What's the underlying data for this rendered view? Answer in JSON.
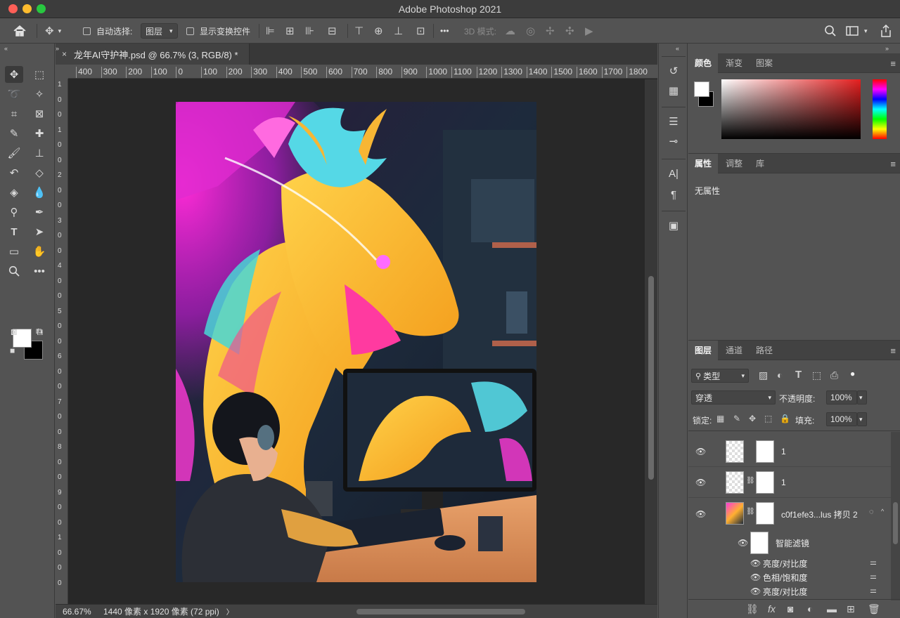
{
  "window": {
    "title": "Adobe Photoshop 2021"
  },
  "options_bar": {
    "auto_select_label": "自动选择:",
    "auto_select_target": "图层",
    "show_transform_label": "显示变换控件",
    "more_label": "•••",
    "mode_3d_label": "3D 模式:"
  },
  "document": {
    "tab_title": "龙年AI守护神.psd @ 66.7% (3, RGB/8) *",
    "close_glyph": "×",
    "zoom": "66.67%",
    "info": "1440 像素 x 1920 像素 (72 ppi)",
    "info_arrow": "〉"
  },
  "ruler_h": [
    "400",
    "300",
    "200",
    "100",
    "0",
    "100",
    "200",
    "300",
    "400",
    "500",
    "600",
    "700",
    "800",
    "900",
    "1000",
    "1100",
    "1200",
    "1300",
    "1400",
    "1500",
    "1600",
    "1700",
    "1800"
  ],
  "ruler_v": [
    "1",
    "0",
    "0",
    "1",
    "0",
    "0",
    "2",
    "0",
    "0",
    "3",
    "0",
    "0",
    "4",
    "0",
    "0",
    "5",
    "0",
    "0",
    "6",
    "0",
    "0",
    "7",
    "0",
    "0",
    "8",
    "0",
    "0",
    "9",
    "0",
    "0",
    "1",
    "0",
    "0",
    "0"
  ],
  "color_panel": {
    "tabs": [
      "颜色",
      "渐变",
      "图案"
    ]
  },
  "properties_panel": {
    "tabs": [
      "属性",
      "调整",
      "库"
    ],
    "empty_text": "无属性"
  },
  "layers_panel": {
    "tabs": [
      "图层",
      "通道",
      "路径"
    ],
    "filter_label": "类型",
    "blend_mode": "穿透",
    "opacity_label": "不透明度:",
    "opacity_value": "100%",
    "lock_label": "锁定:",
    "fill_label": "填充:",
    "fill_value": "100%",
    "layers": [
      {
        "name": "1"
      },
      {
        "name": "1"
      },
      {
        "name": "c0f1efe3...lus 拷贝 2"
      }
    ],
    "smart_filter_label": "智能滤镜",
    "filters": [
      "亮度/对比度",
      "色相/饱和度",
      "亮度/对比度"
    ],
    "fx_label": "fx"
  },
  "colors": {
    "panel_bg": "#535353",
    "canvas_bg": "#282828",
    "foreground": "#ffffff",
    "background": "#000000"
  }
}
